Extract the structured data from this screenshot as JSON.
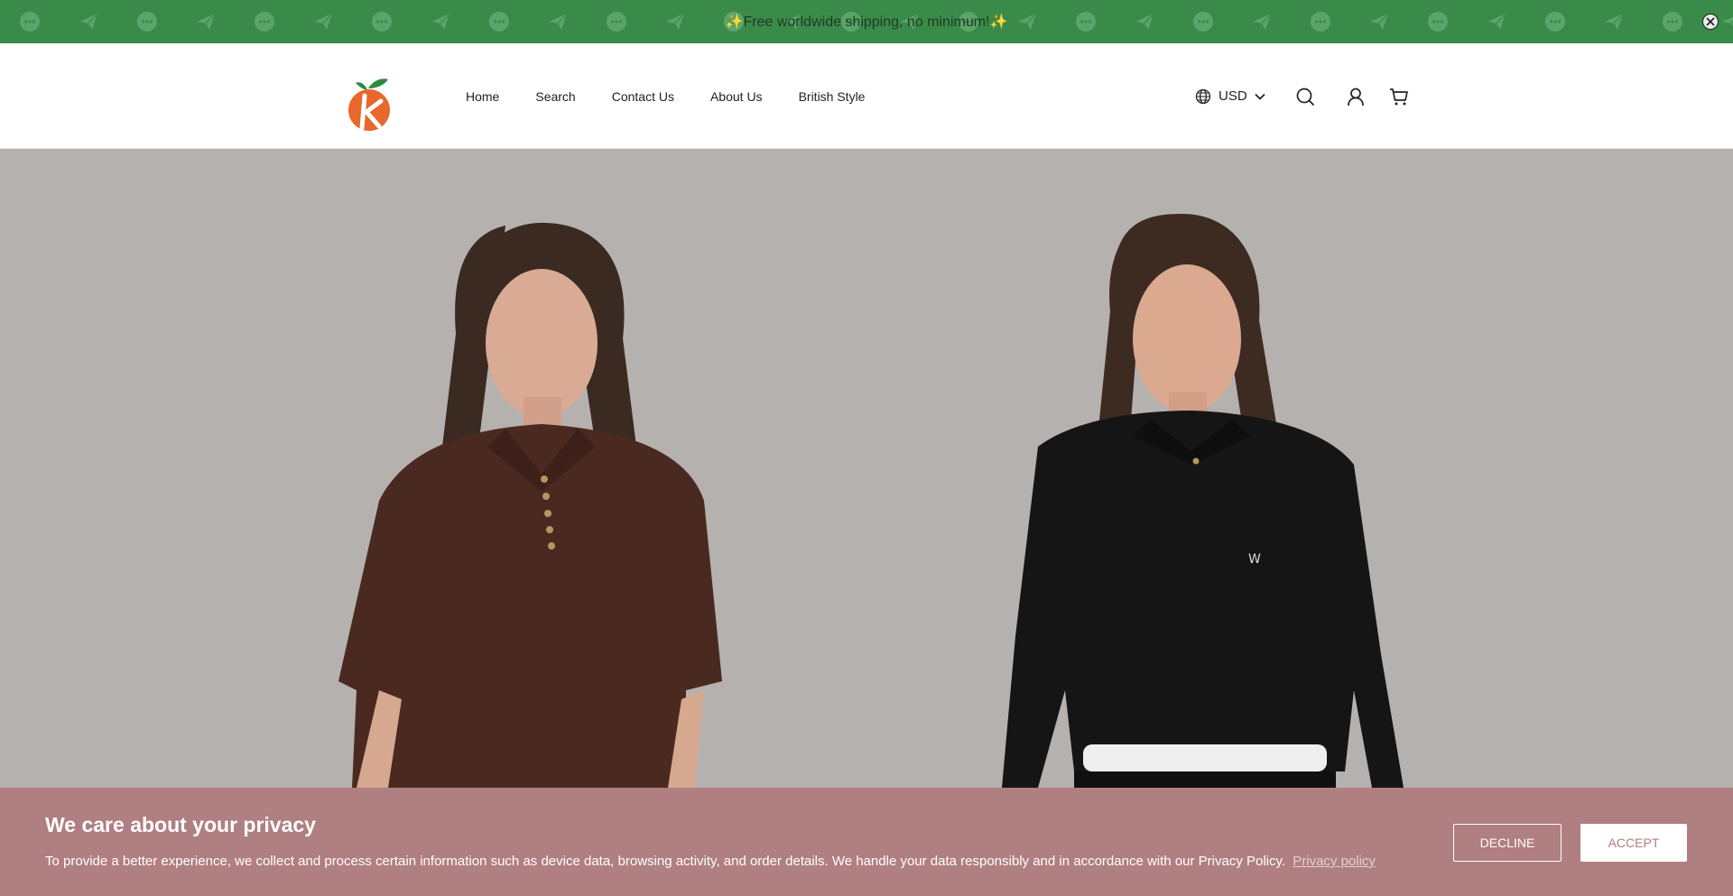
{
  "announcement": {
    "text": "✨Free worldwide shipping, no minimum!✨",
    "close_icon": "close-circle-icon",
    "bg_color": "#3a8b49"
  },
  "header": {
    "logo_alt": "peach-logo",
    "nav": [
      {
        "label": "Home"
      },
      {
        "label": "Search"
      },
      {
        "label": "Contact Us"
      },
      {
        "label": "About Us"
      },
      {
        "label": "British Style"
      }
    ],
    "currency": {
      "label": "USD",
      "icon": "globe-icon"
    },
    "icons": [
      "search-icon",
      "account-icon",
      "cart-icon"
    ]
  },
  "hero": {
    "description": "",
    "bg_color": "#b5b1ae"
  },
  "cookie_banner": {
    "title": "We care about your privacy",
    "body": "To provide a better experience, we collect and process certain information such as device data, browsing activity, and order details. We handle your data responsibly and in accordance with our Privacy Policy.",
    "link": "Privacy policy",
    "decline": "DECLINE",
    "accept": "ACCEPT",
    "bg_color": "#b07f81"
  }
}
